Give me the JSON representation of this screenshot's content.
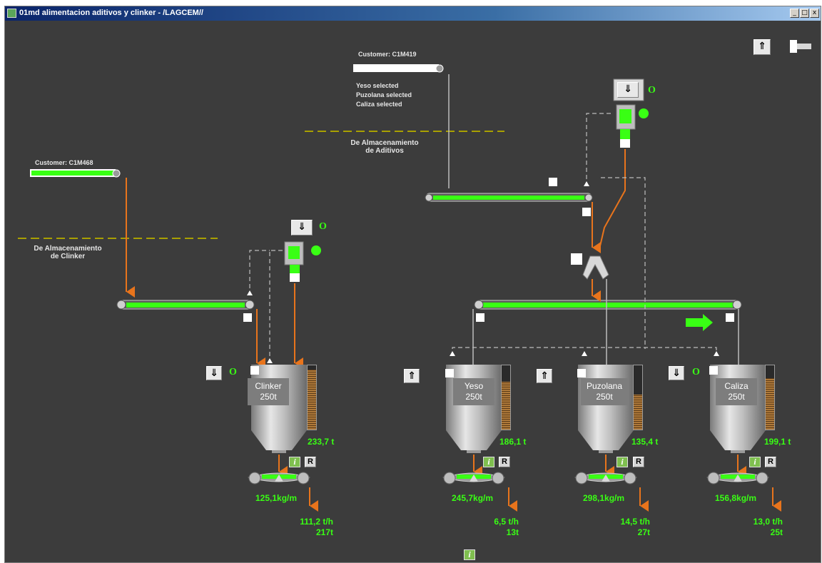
{
  "window": {
    "title": "01md alimentacion aditivos y clinker - /LAGCEM//",
    "min_label": "_",
    "max_label": "□",
    "close_label": "x"
  },
  "toolbar": {
    "up_label": "⇑"
  },
  "clinker_line": {
    "customer_label": "Customer: C1M468",
    "customer_progress": 0.95,
    "source_label": "De Almacenamiento\nde Clinker",
    "silo": {
      "name": "Clinker\n250t",
      "level": 0.93,
      "tonnage": "233,7 t",
      "direction_label": "⇓",
      "state_label": "O",
      "info_label": "i",
      "reset_label": "R",
      "feed_rate": "125,1kg/m",
      "flow": "111,2 t/h",
      "total": "217t"
    },
    "head_button_label": "⇓",
    "head_state_label": "O"
  },
  "additives_line": {
    "customer_label": "Customer: C1M419",
    "customer_progress": 0.95,
    "selections": [
      "Yeso selected",
      "Puzolana selected",
      "Caliza selected"
    ],
    "source_label": "De Almacenamiento\nde Aditivos",
    "head_button_label": "⇓",
    "head_state_label": "O",
    "silos": [
      {
        "id": "yeso",
        "name": "Yeso\n250t",
        "level": 0.74,
        "tonnage": "186,1 t",
        "direction_label": "⇑",
        "info_label": "i",
        "reset_label": "R",
        "feed_rate": "245,7kg/m",
        "flow": "6,5 t/h",
        "total": "13t"
      },
      {
        "id": "puzolana",
        "name": "Puzolana\n250t",
        "level": 0.54,
        "tonnage": "135,4 t",
        "direction_label": "⇑",
        "info_label": "i",
        "reset_label": "R",
        "feed_rate": "298,1kg/m",
        "flow": "14,5 t/h",
        "total": "27t"
      },
      {
        "id": "caliza",
        "name": "Caliza\n250t",
        "level": 0.8,
        "tonnage": "199,1 t",
        "direction_label": "⇓",
        "state_label": "O",
        "info_label": "i",
        "reset_label": "R",
        "feed_rate": "156,8kg/m",
        "flow": "13,0 t/h",
        "total": "25t"
      }
    ]
  },
  "footer": {
    "info_label": "i"
  },
  "colors": {
    "background": "#3c3c3c",
    "running": "#39ff14",
    "material_flow": "#e8741c",
    "return_line": "#cfcfcf",
    "divider": "#a8a000"
  }
}
